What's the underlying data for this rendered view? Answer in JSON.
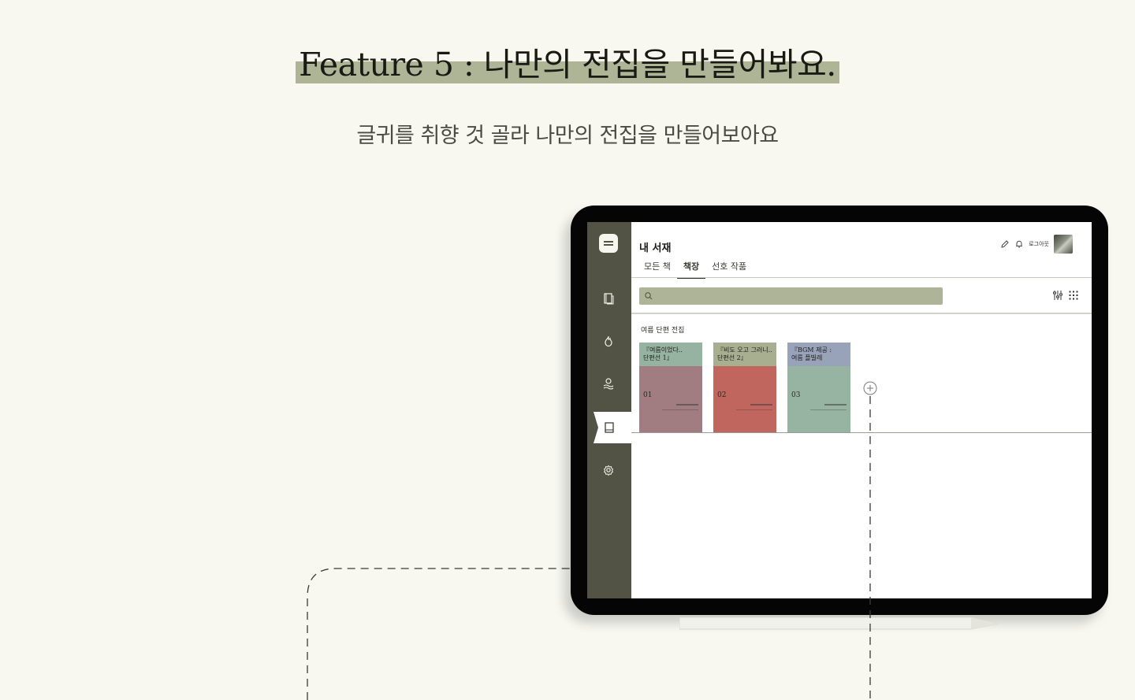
{
  "headline": "Feature 5 : 나만의 전집을 만들어봐요.",
  "subtitle": "글귀를 취향 것 골라 나만의 전집을 만들어보아요",
  "app": {
    "title": "내 서재",
    "logout_label": "로그아웃",
    "tabs": [
      {
        "label": "모든 책",
        "active": false
      },
      {
        "label": "책장",
        "active": true
      },
      {
        "label": "선호 작품",
        "active": false
      }
    ],
    "section_label": "여름 단편 전집",
    "books": [
      {
        "title_line1": "『여름이었다..",
        "title_line2": "단편선 1』",
        "number": "01",
        "band_color": "#96b2a0",
        "body_color": "#a17d81"
      },
      {
        "title_line1": "『비도 오고 그러니..",
        "title_line2": "단편선 2』",
        "number": "02",
        "band_color": "#a8ae90",
        "body_color": "#c0665f"
      },
      {
        "title_line1": "『BGM 제공 :",
        "title_line2": "여름 플빌레",
        "number": "03",
        "band_color": "#98a2b8",
        "body_color": "#97b4a3"
      }
    ],
    "sidebar_icons": [
      "logo-icon",
      "library-icon",
      "flame-icon",
      "user-wave-icon",
      "book-icon",
      "settings-icon"
    ],
    "top_icons": [
      "pencil-icon",
      "bell-icon",
      "avatar"
    ],
    "tool_icons": [
      "filter-icon",
      "grid-icon"
    ]
  },
  "colors": {
    "background": "#f8f8f1",
    "accent": "#adb497",
    "sidebar": "#525345"
  }
}
